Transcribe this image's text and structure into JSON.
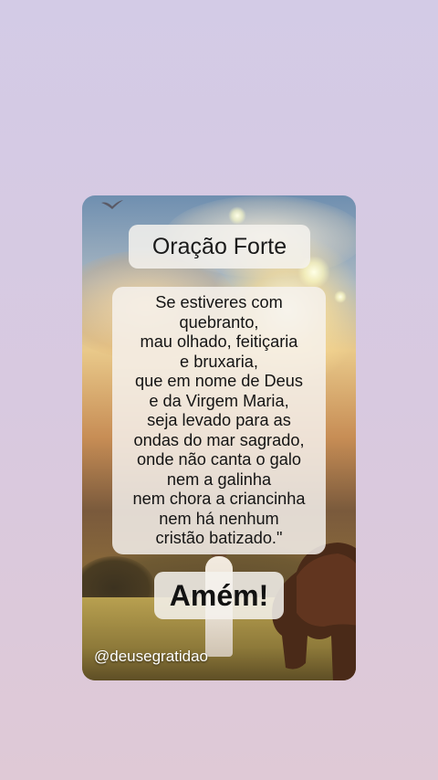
{
  "title": "Oração Forte",
  "prayer": {
    "lines": [
      "Se estiveres com",
      "quebranto,",
      "mau olhado, feitiçaria",
      "e bruxaria,",
      "que em nome de Deus",
      "e da Virgem Maria,",
      "seja levado para as",
      "ondas do mar sagrado,",
      "onde não canta o galo",
      "nem a galinha",
      "nem chora a criancinha",
      "nem há nenhum",
      "cristão batizado.\""
    ]
  },
  "closing": "Amém!",
  "handle": "@deusegratidao",
  "colors": {
    "background_top": "#d3cbe6",
    "background_bottom": "#dfc9d6",
    "text_box": "#f5f2ee",
    "text": "#141414"
  }
}
